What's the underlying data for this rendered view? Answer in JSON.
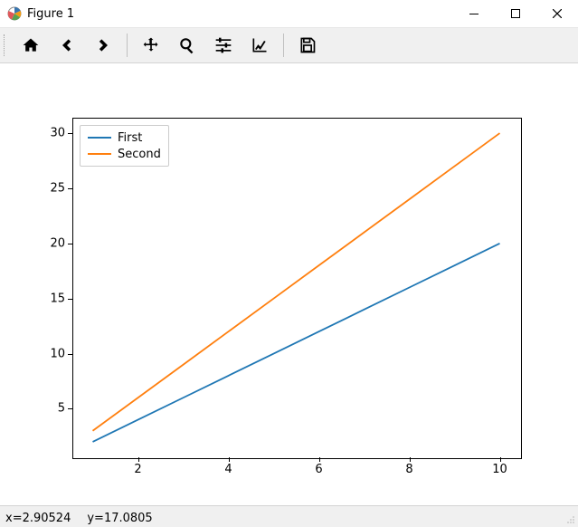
{
  "window": {
    "title": "Figure 1"
  },
  "toolbar": {
    "home": "Home",
    "back": "Back",
    "forward": "Forward",
    "pan": "Pan",
    "zoom": "Zoom",
    "subplots": "Configure subplots",
    "axes": "Edit axes",
    "save": "Save"
  },
  "status": {
    "x": "x=2.90524",
    "y": "y=17.0805"
  },
  "legend": {
    "items": [
      "First",
      "Second"
    ]
  },
  "chart_data": {
    "type": "line",
    "x": [
      1,
      2,
      3,
      4,
      5,
      6,
      7,
      8,
      9,
      10
    ],
    "series": [
      {
        "name": "First",
        "values": [
          2,
          4,
          6,
          8,
          10,
          12,
          14,
          16,
          18,
          20
        ],
        "color": "#1f77b4"
      },
      {
        "name": "Second",
        "values": [
          3,
          6,
          9,
          12,
          15,
          18,
          21,
          24,
          27,
          30
        ],
        "color": "#ff7f0e"
      }
    ],
    "xlim": [
      1,
      10
    ],
    "ylim": [
      2,
      30
    ],
    "xticks": [
      2,
      4,
      6,
      8,
      10
    ],
    "yticks": [
      5,
      10,
      15,
      20,
      25,
      30
    ],
    "title": "",
    "xlabel": "",
    "ylabel": "",
    "legend_loc": "upper-left"
  },
  "colors": {
    "first": "#1f77b4",
    "second": "#ff7f0e"
  }
}
